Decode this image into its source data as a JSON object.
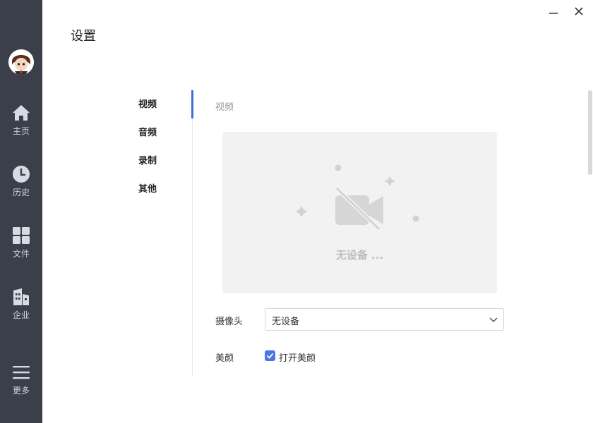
{
  "window": {
    "minimize_icon": "minimize-icon",
    "close_icon": "close-icon"
  },
  "sidebar": {
    "items": [
      {
        "label": "主页",
        "icon": "home-icon"
      },
      {
        "label": "历史",
        "icon": "clock-icon"
      },
      {
        "label": "文件",
        "icon": "grid-icon"
      },
      {
        "label": "企业",
        "icon": "building-icon"
      },
      {
        "label": "更多",
        "icon": "menu-icon"
      }
    ]
  },
  "page": {
    "title": "设置"
  },
  "settings_menu": {
    "items": [
      "视频",
      "音频",
      "录制",
      "其他"
    ],
    "active": "视频"
  },
  "video": {
    "section_title": "视频",
    "preview_text": "无设备 ...",
    "camera_label": "摄像头",
    "camera_value": "无设备",
    "beauty_label": "美颜",
    "beauty_checkbox_label": "打开美颜",
    "beauty_checked": true
  },
  "colors": {
    "sidebar_bg": "#3b3f4a",
    "accent": "#3b6fd8",
    "checkbox": "#4a78e0",
    "preview_bg": "#f2f2f2"
  }
}
